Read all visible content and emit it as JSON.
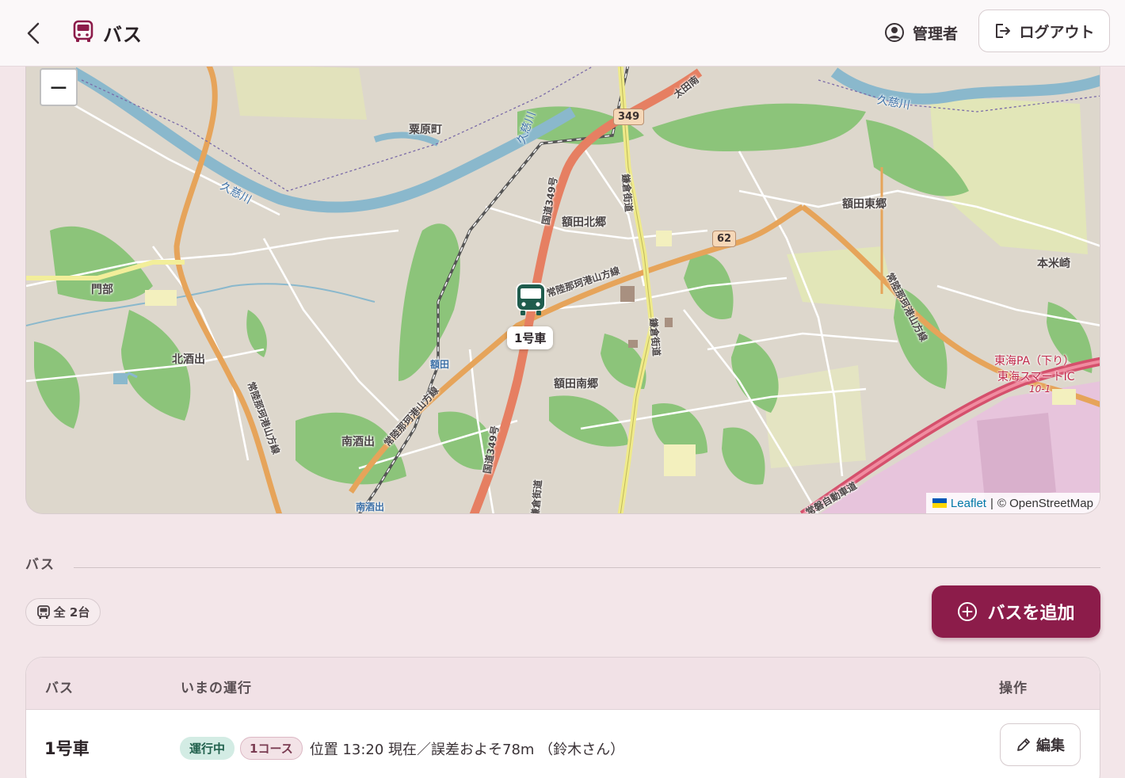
{
  "header": {
    "title": "バス",
    "user_name": "管理者",
    "logout_label": "ログアウト"
  },
  "map": {
    "zoom_out_label": "−",
    "marker_label": "1号車",
    "labels": {
      "kurihara": "粟原町",
      "hokugo": "額田北郷",
      "togo": "額田東郷",
      "motoyoneza": "本米崎",
      "monbe": "門部",
      "kitasakade": "北酒出",
      "nukada": "額田",
      "nango": "額田南郷",
      "minamisakade": "南酒出",
      "minamisakade_station": "南酒出",
      "kuji_river_1": "久慈川",
      "kuji_river_2": "久慈川",
      "kuji_river_3": "久慈川",
      "route_349_shield": "349",
      "route_62_shield": "62",
      "tokai_pa": "東海PA（下り）",
      "tokai_smart_ic": "東海スマートIC",
      "ic_number": "10-1",
      "route_349_a": "国道349号",
      "route_349_b": "国道349号",
      "nakaminato_line_a": "常陸那珂港山方線",
      "nakaminato_line_b": "常陸那珂港山方線",
      "nakaminato_line_c": "常陸那珂港山方線",
      "nakaminato_line_d": "常陸那珂港山方線",
      "kamakura_kaido_a": "鎌倉街道",
      "kamakura_kaido_b": "鎌倉街道",
      "kamakura_kaido_c": "鎌倉街道",
      "expressway": "常磐自動車道",
      "ota_minami": "太田南"
    },
    "attribution": {
      "leaflet": "Leaflet",
      "separator": "|",
      "osm": "© OpenStreetMap"
    }
  },
  "section": {
    "title": "バス",
    "count_label": "全 2台",
    "add_button_label": "バスを追加"
  },
  "table": {
    "headers": {
      "bus": "バス",
      "current_run": "いまの運行",
      "actions": "操作"
    },
    "rows": [
      {
        "name": "1号車",
        "status": "運行中",
        "course": "1コース",
        "position": "位置 13:20 現在／誤差およそ78m （鈴木さん）",
        "edit_label": "編集"
      }
    ]
  },
  "colors": {
    "accent": "#8c1c4a",
    "background": "#f3e6e9",
    "running_badge": "#d3ece4",
    "marker": "#1f5c4d"
  }
}
